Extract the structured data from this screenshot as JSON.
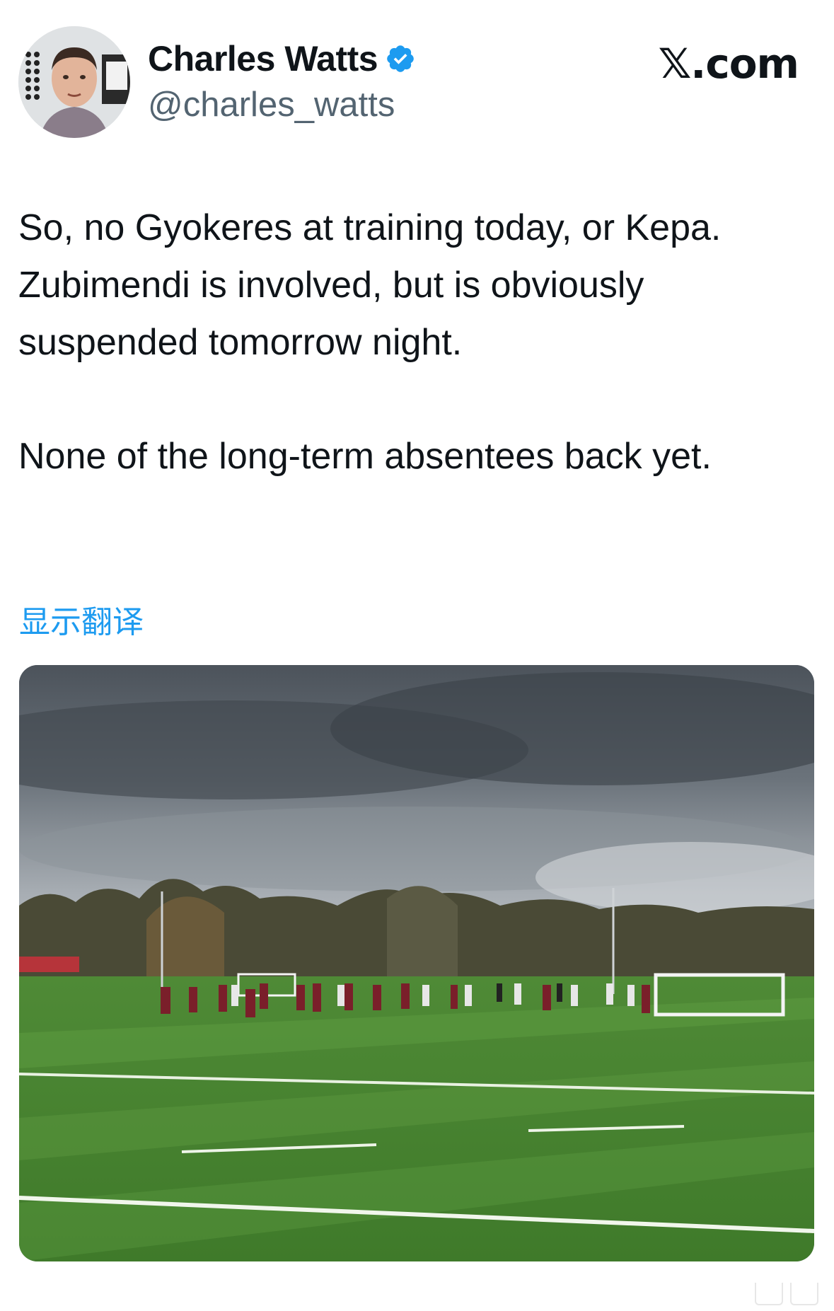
{
  "author": {
    "name": "Charles Watts",
    "handle": "@charles_watts",
    "verified": true,
    "avatar_icon": "profile-photo"
  },
  "brand": "𝕏.com",
  "tweet": {
    "paragraphs": [
      "So, no Gyokeres at training today, or Kepa. Zubimendi is involved, but is obviously suspended tomorrow night.",
      "None of the long-term absentees back yet."
    ]
  },
  "translate_link": "显示翻译",
  "media": {
    "description_icon": "training-pitch-photo"
  },
  "colors": {
    "accent": "#1d9bf0",
    "text": "#0f1419",
    "secondary": "#536471"
  }
}
